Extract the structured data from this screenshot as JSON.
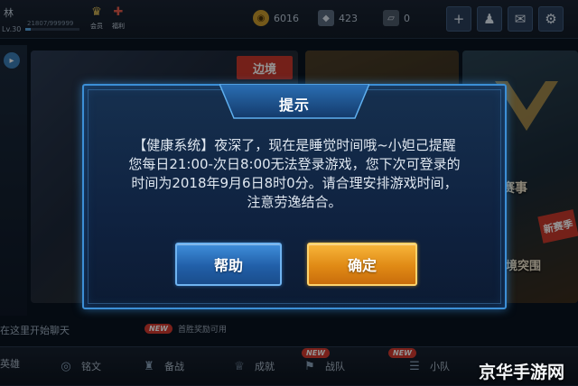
{
  "topbar": {
    "player_id": "林",
    "level": "Lv.30",
    "exp_text": "21807/999999",
    "exp_fraction": 0.1,
    "mini_items": [
      {
        "label": "会员",
        "icon": "crown-icon",
        "glyph": "♛"
      },
      {
        "label": "福利",
        "icon": "gift-icon",
        "glyph": "✚"
      }
    ],
    "gold": "6016",
    "diamonds": "423",
    "tickets": "0",
    "buttons": [
      {
        "name": "add-friend-button",
        "glyph": "+"
      },
      {
        "name": "friends-button",
        "glyph": "♟"
      },
      {
        "name": "mail-button",
        "glyph": "✉"
      },
      {
        "name": "settings-button",
        "glyph": "⚙"
      }
    ]
  },
  "background": {
    "card_tag": "边境",
    "card_label_event": "赛事",
    "card_label_breakthrough": "境突围",
    "card_badge": "新赛季"
  },
  "dialog": {
    "title": "提示",
    "message_lines": [
      "【健康系统】夜深了，现在是睡觉时间哦~小妲己提醒",
      "您每日21:00-次日8:00无法登录游戏，您下次可登录的",
      "时间为2018年9月6日8时0分。请合理安排游戏时间，",
      "注意劳逸结合。"
    ],
    "help_label": "帮助",
    "ok_label": "确定"
  },
  "bottom": {
    "chat_hint": "在这里开始聊天",
    "notice": "首胜奖励可用",
    "new_label": "NEW",
    "nav": [
      {
        "label": "英雄",
        "icon": "hero-icon",
        "glyph": "☗"
      },
      {
        "label": "铭文",
        "icon": "inscription-icon",
        "glyph": "◎"
      },
      {
        "label": "备战",
        "icon": "prepare-icon",
        "glyph": "♜"
      },
      {
        "label": "成就",
        "icon": "achievement-icon",
        "glyph": "♕"
      },
      {
        "label": "战队",
        "icon": "team-icon",
        "glyph": "⚑"
      },
      {
        "label": "小队",
        "icon": "squad-icon",
        "glyph": "☰"
      }
    ]
  },
  "watermark": "京华手游网"
}
